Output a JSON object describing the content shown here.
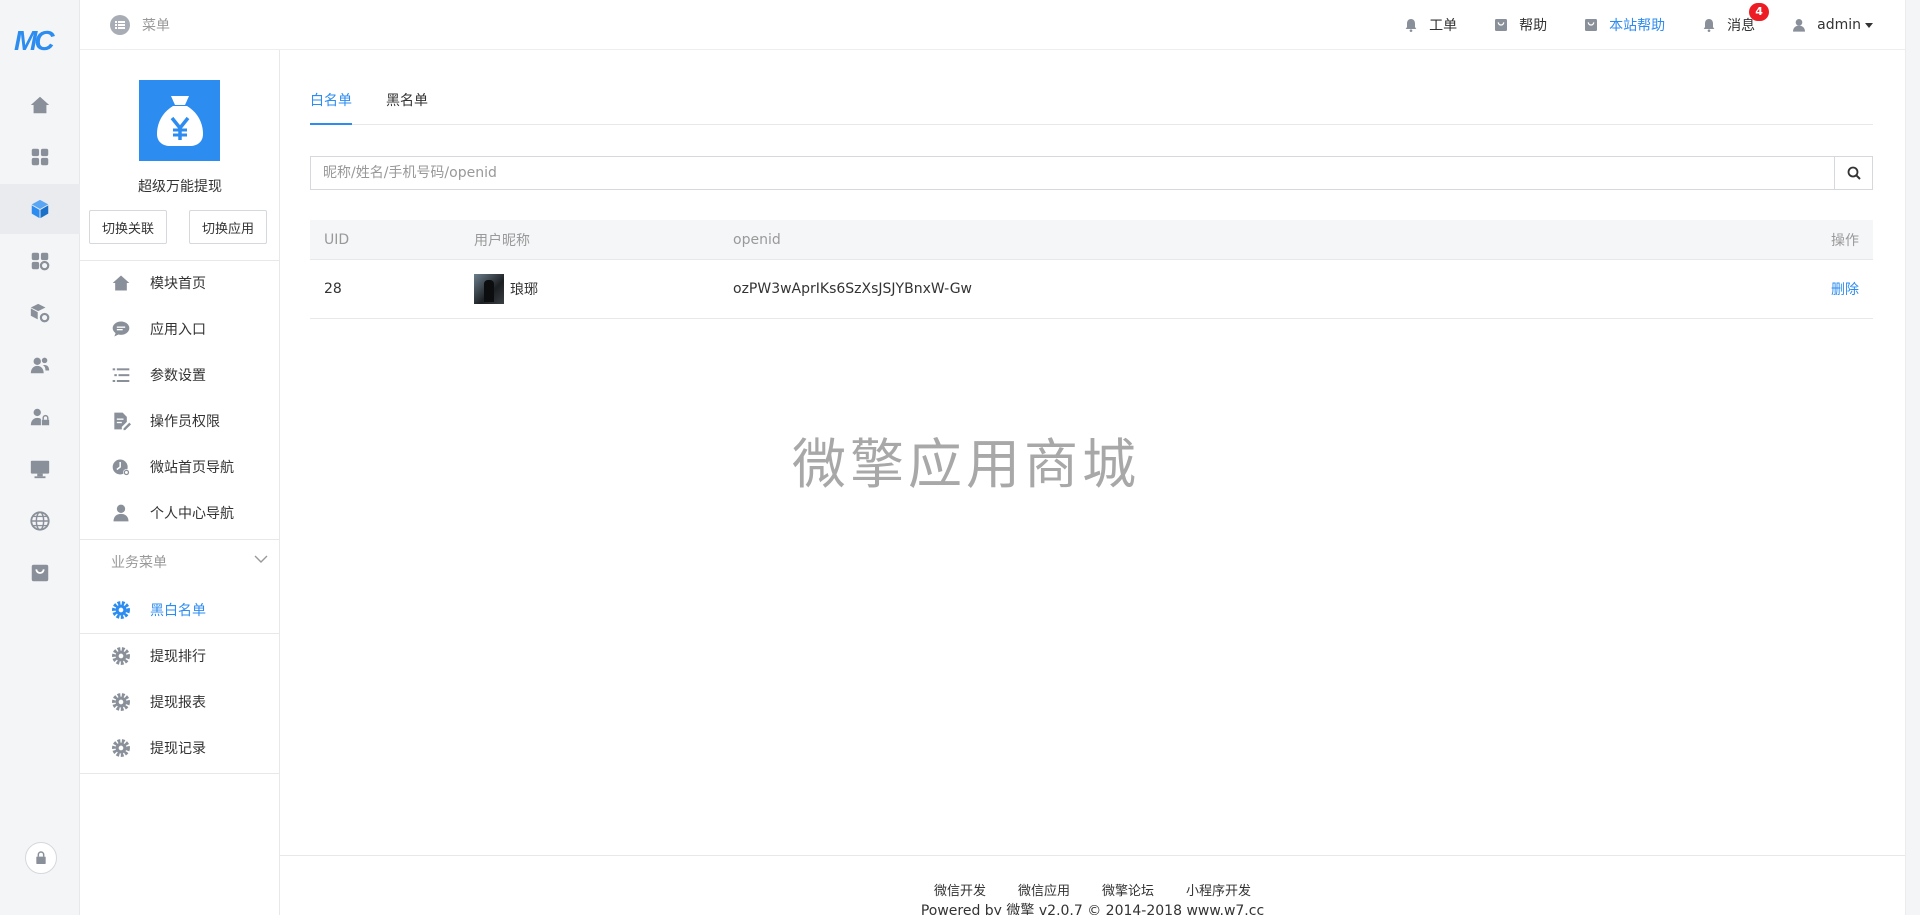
{
  "brand": {
    "logo_text": "MC"
  },
  "header": {
    "menu_label": "菜单",
    "links": [
      {
        "label": "工单",
        "icon": "bell-icon"
      },
      {
        "label": "帮助",
        "icon": "bag-icon"
      },
      {
        "label": "本站帮助",
        "icon": "bag-icon"
      },
      {
        "label": "消息",
        "icon": "bell-icon",
        "badge": "4"
      }
    ],
    "user": "admin"
  },
  "rail": {
    "items": [
      "home-icon",
      "apps-grid-icon",
      "module-cube-icon",
      "app-settings-icon",
      "cube-settings-icon",
      "users-icon",
      "user-lock-icon",
      "monitor-icon",
      "globe-icon",
      "store-bag-icon"
    ],
    "active_index": 2
  },
  "module": {
    "name": "超级万能提现",
    "switch_link": "切换关联",
    "switch_app": "切换应用",
    "menu": [
      {
        "label": "模块首页",
        "icon": "home-icon"
      },
      {
        "label": "应用入口",
        "icon": "chat-icon"
      },
      {
        "label": "参数设置",
        "icon": "list-settings-icon"
      },
      {
        "label": "操作员权限",
        "icon": "edit-doc-icon"
      },
      {
        "label": "微站首页导航",
        "icon": "clock-nav-icon"
      },
      {
        "label": "个人中心导航",
        "icon": "person-icon"
      }
    ],
    "business_title": "业务菜单",
    "business_menu": [
      {
        "label": "黑白名单",
        "active": true
      },
      {
        "label": "提现排行",
        "active": false
      },
      {
        "label": "提现报表",
        "active": false
      },
      {
        "label": "提现记录",
        "active": false
      }
    ]
  },
  "main": {
    "tabs": [
      "白名单",
      "黑名单"
    ],
    "active_tab": 0,
    "search_placeholder": "昵称/姓名/手机号码/openid",
    "table": {
      "headers": [
        "UID",
        "用户昵称",
        "openid",
        "操作"
      ],
      "rows": [
        {
          "uid": "28",
          "nickname": "琅琊",
          "openid": "ozPW3wAprIKs6SzXsJSJYBnxW-Gw",
          "action": "删除"
        }
      ]
    },
    "watermark": "微擎应用商城"
  },
  "footer": {
    "links": [
      "微信开发",
      "微信应用",
      "微擎论坛",
      "小程序开发"
    ],
    "copyright": "Powered by 微擎 v2.0.7 © 2014-2018 www.w7.cc"
  },
  "colors": {
    "accent": "#2d8cf0",
    "badge": "#ed1c24",
    "icon_gray": "#8a9099"
  }
}
